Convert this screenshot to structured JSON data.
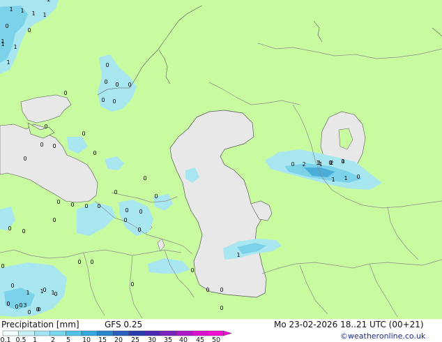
{
  "map": {
    "colors": {
      "land": "#c8fba0",
      "sea": "#e8e8e8",
      "border": "#8a8a8a",
      "coast": "#555555",
      "precip_light": "#a8e6f0",
      "precip_mid": "#7cd2e8",
      "precip_heavy": "#4aaed8"
    },
    "precip_values": [
      "1",
      "1",
      "1",
      "1",
      "1",
      "2",
      "0",
      "0",
      "1",
      "1",
      "1",
      "0",
      "0",
      "0",
      "0",
      "0",
      "0",
      "0",
      "0",
      "0",
      "0",
      "0",
      "0",
      "0",
      "0",
      "0",
      "0",
      "0",
      "0",
      "0",
      "0",
      "0",
      "0",
      "0",
      "0",
      "0",
      "0",
      "0",
      "1",
      "0",
      "0",
      "0",
      "0",
      "0",
      "0",
      "0",
      "0",
      "0",
      "0",
      "0",
      "2",
      "1",
      "1",
      "1",
      "1",
      "1",
      "0",
      "2",
      "1",
      "1",
      "0",
      "0",
      "1",
      "0",
      "0",
      "0",
      "0",
      "0",
      "3",
      "1",
      "0",
      "0",
      "1",
      "0"
    ]
  },
  "footer": {
    "title": "Precipitation [mm]",
    "model": "GFS 0.25",
    "valid_time": "Mo 23-02-2026 18..21 UTC (00+21)",
    "credit": "©weatheronline.co.uk"
  },
  "legend": {
    "ticks": [
      "0.1",
      "0.5",
      "1",
      "2",
      "5",
      "10",
      "15",
      "20",
      "25",
      "30",
      "35",
      "40",
      "45",
      "50"
    ],
    "colors": [
      "#f0fcfe",
      "#c8f0f8",
      "#a0e4f4",
      "#78d6ee",
      "#4fc4e6",
      "#34a8dc",
      "#2a86cc",
      "#2a5ec0",
      "#2a3cae",
      "#4a2ab4",
      "#7a22be",
      "#aa1ac8",
      "#d814cc",
      "#f010d4"
    ]
  }
}
